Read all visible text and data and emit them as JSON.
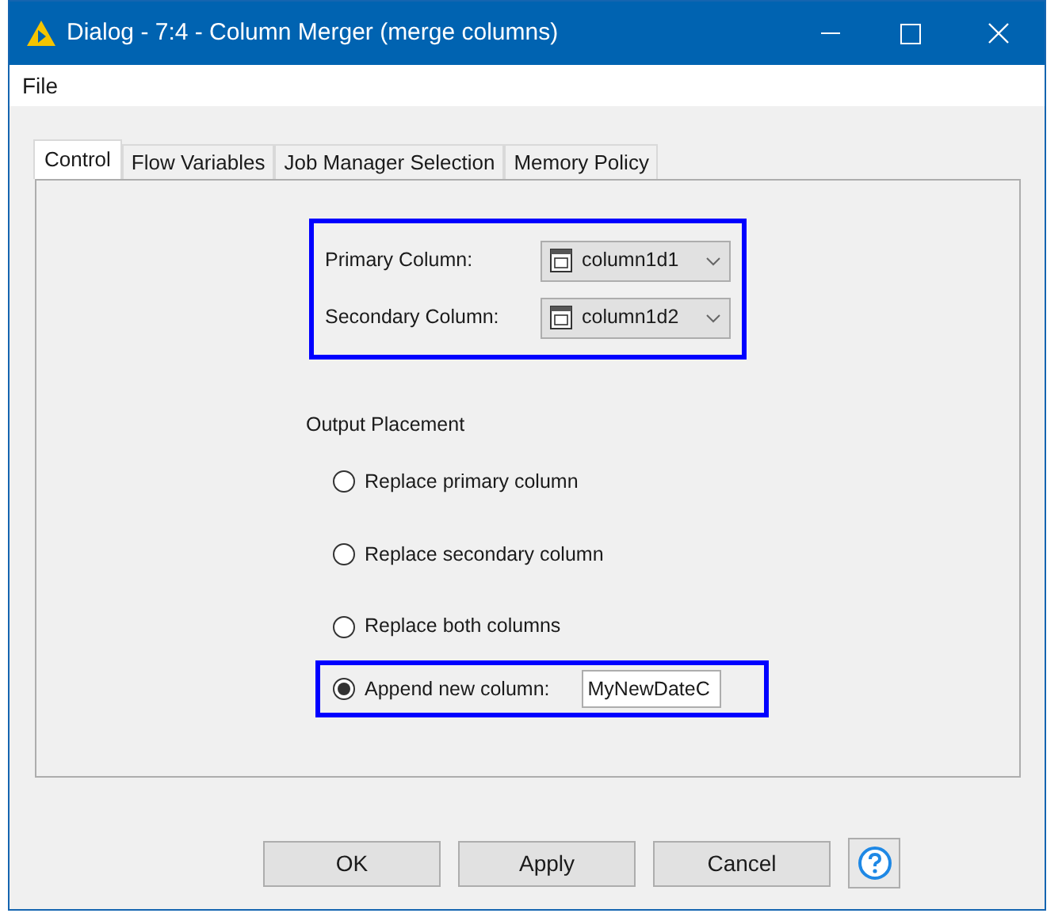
{
  "window": {
    "title": "Dialog - 7:4 - Column Merger (merge columns)"
  },
  "menu": [
    "File"
  ],
  "tabs": [
    {
      "label": "Control",
      "selected": true
    },
    {
      "label": "Flow Variables",
      "selected": false
    },
    {
      "label": "Job Manager Selection",
      "selected": false
    },
    {
      "label": "Memory Policy",
      "selected": false
    }
  ],
  "columns": [
    {
      "label": "Primary Column:",
      "value": "column1d1"
    },
    {
      "label": "Secondary Column:",
      "value": "column1d2"
    }
  ],
  "output_placement": {
    "title": "Output Placement",
    "options": [
      {
        "label": "Replace primary column",
        "selected": false
      },
      {
        "label": "Replace secondary column",
        "selected": false
      },
      {
        "label": "Replace both columns",
        "selected": false
      },
      {
        "label": "Append new column:",
        "selected": true,
        "value": "MyNewDateC"
      }
    ]
  },
  "buttons": [
    "OK",
    "Apply",
    "Cancel"
  ]
}
